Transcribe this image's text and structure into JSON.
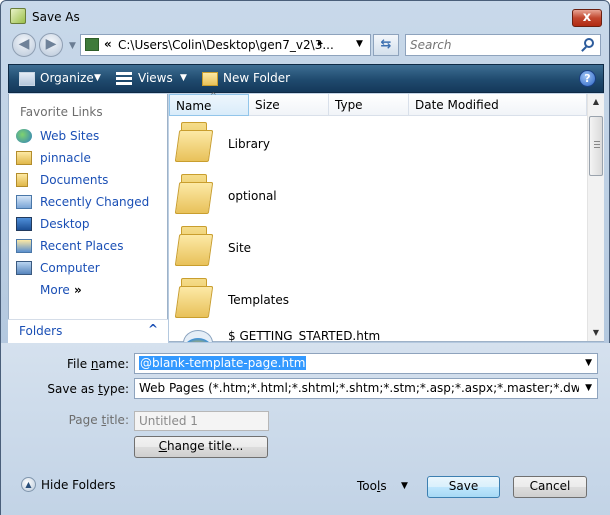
{
  "window": {
    "title": "Save As",
    "close_label": "x"
  },
  "address": {
    "chevrons": "«",
    "path": "C:\\Users\\Colin\\Desktop\\gen7_v2\\3...",
    "arrow": "▸",
    "search_placeholder": "Search"
  },
  "toolbar": {
    "organize_label": "Organize",
    "views_label": "Views",
    "new_folder_label": "New Folder",
    "help_label": "?"
  },
  "sidebar": {
    "favorites_header": "Favorite Links",
    "items": [
      {
        "label": "Web Sites",
        "icon": "globe-icon"
      },
      {
        "label": "pinnacle",
        "icon": "network-folder-icon"
      },
      {
        "label": "Documents",
        "icon": "documents-icon"
      },
      {
        "label": "Recently Changed",
        "icon": "recently-changed-icon"
      },
      {
        "label": "Desktop",
        "icon": "desktop-icon"
      },
      {
        "label": "Recent Places",
        "icon": "recent-places-icon"
      },
      {
        "label": "Computer",
        "icon": "computer-icon"
      }
    ],
    "more_label": "More",
    "more_chevron": "»",
    "folders_label": "Folders",
    "folders_chevron": "^"
  },
  "file_list": {
    "columns": [
      "Name",
      "Size",
      "Type",
      "Date Modified"
    ],
    "sort_indicator": "^",
    "rows": [
      {
        "name": "Library",
        "kind": "folder"
      },
      {
        "name": "optional",
        "kind": "folder"
      },
      {
        "name": "Site",
        "kind": "folder"
      },
      {
        "name": "Templates",
        "kind": "folder"
      },
      {
        "name": "$    GETTING_STARTED.htm",
        "kind": "htm"
      }
    ]
  },
  "form": {
    "file_name_label_prefix": "File ",
    "file_name_label_u": "n",
    "file_name_label_suffix": "ame:",
    "file_name_value": "@blank-template-page.htm",
    "save_type_label_prefix": "Save as ",
    "save_type_label_u": "t",
    "save_type_label_suffix": "ype:",
    "save_type_value": "Web Pages (*.htm;*.html;*.shtml;*.shtm;*.stm;*.asp;*.aspx;*.master;*.dwt;*.htt;*.inc;*",
    "page_title_label_prefix": "Page ",
    "page_title_label_u": "t",
    "page_title_label_suffix": "itle:",
    "page_title_value": "Untitled 1",
    "change_title_u": "C",
    "change_title_rest": "hange title..."
  },
  "footer": {
    "hide_folders_label": "Hide Folders",
    "tools_prefix": "Too",
    "tools_u": "l",
    "tools_suffix": "s",
    "save_label": "Save",
    "cancel_label": "Cancel"
  },
  "colors": {
    "toolbar_bg": "#1f4a6e",
    "link_blue": "#1a4fb5",
    "selection": "#3399ff",
    "form_bg": "#c9d9ea"
  }
}
